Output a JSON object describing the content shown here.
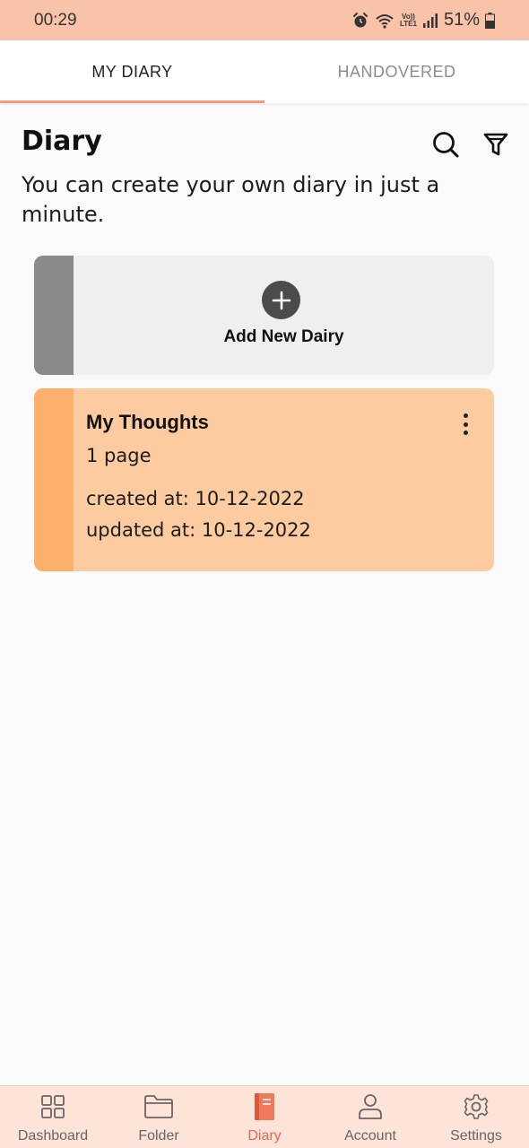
{
  "status_bar": {
    "time": "00:29",
    "lte_top": "Vo))",
    "lte_bottom": "LTE1",
    "battery": "51%"
  },
  "tabs": [
    {
      "label": "MY DIARY",
      "active": true
    },
    {
      "label": "HANDOVERED",
      "active": false
    }
  ],
  "header": {
    "title": "Diary",
    "subtitle": "You can create your own diary in just a minute.",
    "icons": [
      "search-icon",
      "filter-icon"
    ]
  },
  "add_card": {
    "label": "Add New Dairy",
    "icon": "plus-circle-icon"
  },
  "diaries": [
    {
      "title": "My Thoughts",
      "pages": "1 page",
      "created": "created at: 10-12-2022",
      "updated": "updated at: 10-12-2022"
    }
  ],
  "bottom_nav": [
    {
      "label": "Dashboard",
      "icon": "grid-icon",
      "active": false
    },
    {
      "label": "Folder",
      "icon": "folder-icon",
      "active": false
    },
    {
      "label": "Diary",
      "icon": "diary-book-icon",
      "active": true
    },
    {
      "label": "Account",
      "icon": "person-icon",
      "active": false
    },
    {
      "label": "Settings",
      "icon": "gear-icon",
      "active": false
    }
  ],
  "colors": {
    "status_bar": "#f9c3a9",
    "accent": "#f39a7a",
    "diary_card": "#fccca0",
    "diary_strip": "#fdb06c",
    "add_card": "#efefef",
    "nav_active": "#e26a4f",
    "bottom_nav": "#fde3d8"
  }
}
